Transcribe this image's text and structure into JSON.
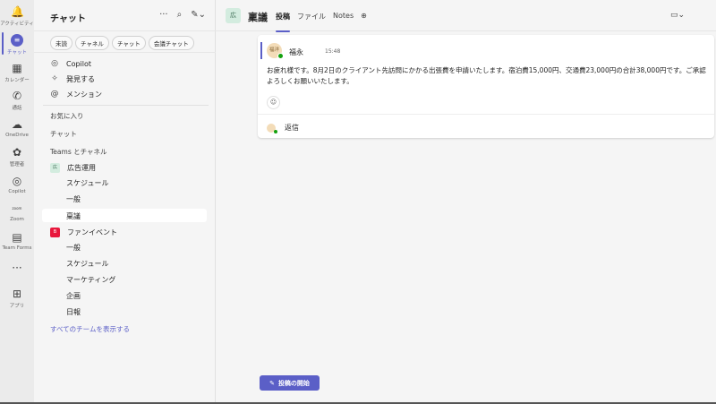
{
  "rail": [
    {
      "label": "アクティビティ",
      "icon": "bell-icon",
      "glyph": "🔔"
    },
    {
      "label": "チャット",
      "icon": "chat-icon",
      "glyph": "≡"
    },
    {
      "label": "カレンダー",
      "icon": "calendar-icon",
      "glyph": "▦"
    },
    {
      "label": "通話",
      "icon": "phone-icon",
      "glyph": "✆"
    },
    {
      "label": "OneDrive",
      "icon": "cloud-icon",
      "glyph": "☁"
    },
    {
      "label": "管理者",
      "icon": "admin-icon",
      "glyph": "✿"
    },
    {
      "label": "Copilot",
      "icon": "copilot-icon",
      "glyph": "◎"
    },
    {
      "label": "Zoom",
      "icon": "zoom-icon",
      "glyph": "zoom"
    },
    {
      "label": "Team Forms",
      "icon": "forms-icon",
      "glyph": "▤"
    },
    {
      "label": "",
      "icon": "more-icon",
      "glyph": "···"
    },
    {
      "label": "アプリ",
      "icon": "apps-icon",
      "glyph": "⊞"
    }
  ],
  "side": {
    "title": "チャット",
    "filters": [
      "未読",
      "チャネル",
      "チャット",
      "会議チャット"
    ],
    "quick": [
      {
        "label": "Copilot",
        "glyph": "◎"
      },
      {
        "label": "発見する",
        "glyph": "✧"
      },
      {
        "label": "メンション",
        "glyph": "@"
      }
    ],
    "sections": {
      "favorites": "お気に入り",
      "chats": "チャット",
      "teams": "Teams とチャネル"
    },
    "team1": {
      "name": "広告運用",
      "abbr": "広",
      "channels": [
        "スケジュール",
        "一般",
        "稟議"
      ]
    },
    "team2": {
      "name": "ファンイベント",
      "abbr": "B",
      "channels": [
        "一般",
        "スケジュール",
        "マーケティング",
        "企画",
        "日報"
      ]
    },
    "show_all": "すべてのチームを表示する"
  },
  "header": {
    "channel_abbr": "広",
    "channel": "稟議",
    "tabs": [
      "投稿",
      "ファイル",
      "Notes"
    ],
    "add": "⊕"
  },
  "post": {
    "avatar": "福洋",
    "author": "福永",
    "time": "15:48",
    "body": "お疲れ様です。8月2日のクライアント先訪問にかかる出張費を申請いたします。宿泊費15,000円、交通費23,000円の合計38,000円です。ご承認よろしくお願いいたします。",
    "reply": "返信"
  },
  "start_post": "投稿の開始",
  "colors": {
    "accent": "#5b5fc7",
    "presence": "#13a10e",
    "team2": "#e8173c"
  }
}
